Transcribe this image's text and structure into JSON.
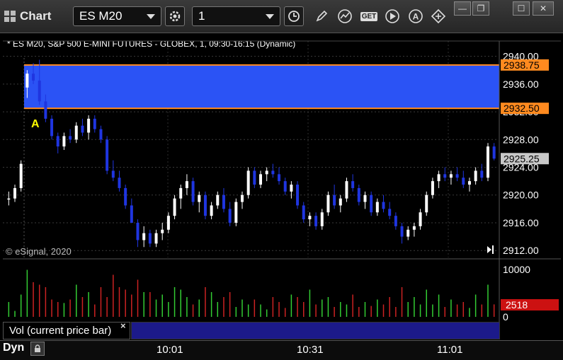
{
  "window": {
    "title": "Chart",
    "symbol": "ES M20",
    "interval": "1",
    "buttons": {
      "minimize": "—",
      "restore": "❐",
      "maximize": "☐",
      "close": "✕"
    }
  },
  "toolbar_icons": [
    "gear-icon",
    "clock-icon",
    "pencil-icon",
    "study-icon",
    "get-icon",
    "play-icon",
    "alert-icon",
    "link-icon"
  ],
  "toolbar_labels": {
    "get": "GET",
    "alert": "A"
  },
  "chart_header": "* ES M20, S&P 500 E-MINI FUTURES - GLOBEX, 1, 09:30-16:15 (Dynamic)",
  "copyright": "© eSignal, 2020",
  "price_axis": {
    "ticks": [
      "2940.00",
      "2936.00",
      "2932.00",
      "2928.00",
      "2924.00",
      "2920.00",
      "2916.00",
      "2912.00"
    ],
    "tag_high": "2938.75",
    "tag_low": "2932.50",
    "tag_last": "2925.25"
  },
  "annotation_label": "A",
  "volume": {
    "panel_label": "Vol (current price bar)",
    "close_glyph": "×",
    "ticks": [
      "10000",
      "0"
    ],
    "current": "2518"
  },
  "time_axis": [
    "10:01",
    "10:31",
    "11:01"
  ],
  "status": {
    "mode": "Dyn"
  },
  "colors": {
    "zone_fill": "#2b53f5",
    "zone_border": "#ff8a1f",
    "tag_orange": "#ff8a1f",
    "up_candle": "#ffffff",
    "down_candle": "#1f35e0",
    "vol_up": "#33cc33",
    "vol_down": "#cc2222",
    "annotation": "#ffff00"
  },
  "chart_data": {
    "type": "candlestick",
    "y_range": [
      2911,
      2942
    ],
    "zone": {
      "high": 2938.75,
      "low": 2932.5
    },
    "last_price": 2925.25,
    "bars": [
      [
        2919.5,
        2920.5,
        2918.5,
        2919.5
      ],
      [
        2919.5,
        2921.5,
        2919,
        2921
      ],
      [
        2921,
        2925,
        2920.5,
        2924.5
      ],
      [
        2935.5,
        2938,
        2934,
        2937.5
      ],
      [
        2937.5,
        2939,
        2936,
        2936.5
      ],
      [
        2936.5,
        2939.5,
        2933,
        2933.5
      ],
      [
        2933.5,
        2934.5,
        2930.5,
        2931
      ],
      [
        2931,
        2931.5,
        2928,
        2928.5
      ],
      [
        2928.5,
        2929,
        2926,
        2927
      ],
      [
        2927,
        2929,
        2926.5,
        2928.5
      ],
      [
        2928.5,
        2929.5,
        2927.5,
        2928
      ],
      [
        2928,
        2930.5,
        2927.5,
        2930
      ],
      [
        2930,
        2931,
        2928.5,
        2929
      ],
      [
        2929,
        2931.5,
        2928,
        2931
      ],
      [
        2931,
        2931.5,
        2929,
        2929.5
      ],
      [
        2929.5,
        2930,
        2927.5,
        2928
      ],
      [
        2928,
        2928.5,
        2923,
        2923.5
      ],
      [
        2923.5,
        2925,
        2922,
        2922.5
      ],
      [
        2922.5,
        2923.5,
        2920.5,
        2921
      ],
      [
        2921,
        2921.5,
        2918,
        2918.5
      ],
      [
        2918.5,
        2919.5,
        2916,
        2916
      ],
      [
        2916,
        2916.5,
        2912.5,
        2913.5
      ],
      [
        2913.5,
        2915.5,
        2912.5,
        2914.5
      ],
      [
        2914.5,
        2915,
        2912.5,
        2913
      ],
      [
        2913,
        2915,
        2912.5,
        2914.5
      ],
      [
        2914.5,
        2916,
        2913.5,
        2915
      ],
      [
        2915,
        2917.5,
        2914.5,
        2917
      ],
      [
        2917,
        2920,
        2916.5,
        2919.5
      ],
      [
        2919.5,
        2921.5,
        2918,
        2921
      ],
      [
        2921,
        2923,
        2920,
        2922
      ],
      [
        2922,
        2922.5,
        2918.5,
        2919
      ],
      [
        2919,
        2920.5,
        2917.5,
        2920
      ],
      [
        2920,
        2920.5,
        2916.5,
        2917
      ],
      [
        2917,
        2919,
        2916.5,
        2918.5
      ],
      [
        2918.5,
        2920.5,
        2918,
        2920
      ],
      [
        2920,
        2921,
        2917.5,
        2918
      ],
      [
        2918,
        2919,
        2915.5,
        2916
      ],
      [
        2916,
        2919.5,
        2915.5,
        2919
      ],
      [
        2919,
        2920.5,
        2918,
        2920
      ],
      [
        2920,
        2924,
        2919.5,
        2923.5
      ],
      [
        2923.5,
        2924,
        2921,
        2921.5
      ],
      [
        2921.5,
        2923.5,
        2921,
        2923
      ],
      [
        2923,
        2924,
        2922,
        2923.5
      ],
      [
        2923.5,
        2924.5,
        2922.5,
        2923
      ],
      [
        2923,
        2924,
        2921.5,
        2922
      ],
      [
        2922,
        2922.5,
        2920,
        2920.5
      ],
      [
        2920.5,
        2922,
        2919.5,
        2921.5
      ],
      [
        2921.5,
        2922,
        2918,
        2918.5
      ],
      [
        2918.5,
        2919,
        2916,
        2916.5
      ],
      [
        2916.5,
        2917.5,
        2915.5,
        2917
      ],
      [
        2917,
        2917.5,
        2915,
        2915.5
      ],
      [
        2915.5,
        2918,
        2915,
        2917.5
      ],
      [
        2917.5,
        2920.5,
        2917,
        2920
      ],
      [
        2920,
        2921.5,
        2918,
        2918.5
      ],
      [
        2918.5,
        2920,
        2917.5,
        2919.5
      ],
      [
        2919.5,
        2922.5,
        2919,
        2922
      ],
      [
        2922,
        2923,
        2920.5,
        2921
      ],
      [
        2921,
        2921.5,
        2918.5,
        2919
      ],
      [
        2919,
        2920.5,
        2918,
        2920
      ],
      [
        2920,
        2920.5,
        2917,
        2917.5
      ],
      [
        2917.5,
        2919.5,
        2917,
        2919
      ],
      [
        2919,
        2920,
        2917.5,
        2918
      ],
      [
        2918,
        2919,
        2916.5,
        2917
      ],
      [
        2917,
        2917.5,
        2915,
        2915.5
      ],
      [
        2915.5,
        2916,
        2913,
        2914
      ],
      [
        2914,
        2915.5,
        2913.5,
        2915
      ],
      [
        2915,
        2916,
        2914,
        2915.5
      ],
      [
        2915.5,
        2918,
        2915,
        2917.5
      ],
      [
        2917.5,
        2920.5,
        2917,
        2920
      ],
      [
        2920,
        2922.5,
        2919.5,
        2922
      ],
      [
        2922,
        2923.5,
        2921,
        2923
      ],
      [
        2923,
        2924,
        2922,
        2922.5
      ],
      [
        2922.5,
        2923.5,
        2921.5,
        2923
      ],
      [
        2923,
        2924,
        2922,
        2922.5
      ],
      [
        2922.5,
        2923.5,
        2921,
        2921.5
      ],
      [
        2921.5,
        2922.5,
        2920.5,
        2922
      ],
      [
        2922,
        2924,
        2921.5,
        2923.5
      ],
      [
        2923.5,
        2924.5,
        2922,
        2922.5
      ],
      [
        2922.5,
        2927.5,
        2922,
        2927
      ],
      [
        2927,
        2927.5,
        2925,
        2925.25
      ]
    ],
    "volume": [
      3000,
      1200,
      4500,
      9500,
      7000,
      6500,
      6000,
      3500,
      3000,
      2800,
      3500,
      6500,
      4000,
      5000,
      2500,
      6000,
      4000,
      8500,
      6000,
      5500,
      4500,
      7500,
      5000,
      5000,
      3500,
      4500,
      3000,
      6000,
      5500,
      4000,
      2500,
      3500,
      6000,
      5000,
      3000,
      4000,
      5000,
      2000,
      3500,
      2500,
      3500,
      2500,
      1500,
      4000,
      3000,
      1800,
      4500,
      4000,
      3000,
      5500,
      2500,
      3500,
      4000,
      2000,
      3000,
      2500,
      4500,
      2000,
      3000,
      2200,
      3500,
      2500,
      4000,
      2000,
      6000,
      3000,
      4000,
      2500,
      5500,
      2500,
      4500,
      2000,
      3500,
      2500,
      3000,
      1800,
      4500,
      2500,
      6500,
      2518
    ]
  }
}
